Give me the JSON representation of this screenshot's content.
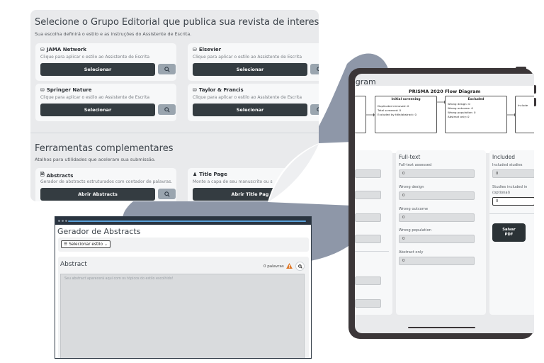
{
  "publisher_panel": {
    "title": "Selecione o Grupo Editorial que publica sua revista de interesse",
    "subtitle": "Sua escolha definirá o estilo e as instruções do Assistente de Escrita.",
    "card_description": "Clique para aplicar o estilo ao Assistente de Escrita",
    "select_label": "Selecionar",
    "publishers": [
      {
        "name": "JAMA Network",
        "icon": "database-icon"
      },
      {
        "name": "Elsevier",
        "icon": "database-icon"
      },
      {
        "name": "Springer Nature",
        "icon": "database-icon"
      },
      {
        "name": "Taylor & Francis",
        "icon": "database-icon"
      }
    ],
    "tools_title": "Ferramentas complementares",
    "tools_subtitle": "Atalhos para utilidades que aceleram sua submissão.",
    "tools": [
      {
        "name": "Abstracts",
        "description": "Gerador de abstracts estruturados com contador de palavras.",
        "button": "Abrir Abstracts",
        "icon": "document-icon"
      },
      {
        "name": "Title Page",
        "description": "Monte a capa de seu manuscrito ou s",
        "button": "Abrir Title Pag",
        "icon": "user-group-icon"
      }
    ]
  },
  "abstract_window": {
    "title": "Gerador de Abstracts",
    "style_button": "Selecionar estilo",
    "section_title": "Abstract",
    "word_count": "0 palavras",
    "placeholder": "Seu abstract aparecerá aqui com os tópicos do estilo escolhido!"
  },
  "tablet": {
    "partial_title": "agram",
    "prisma": {
      "title": "PRISMA 2020 Flow Diagram",
      "initial_screening": {
        "title": "Initial screening",
        "lines": [
          "Duplicated removed: 0",
          "Total screened: 0",
          "Excluded by title/abstract: 0"
        ]
      },
      "excluded": {
        "title": "Excluded",
        "lines": [
          "Wrong design: 0",
          "Wrong outcome: 0",
          "Wrong population: 0",
          "Abstract only: 0"
        ]
      },
      "partial_box": "Include"
    },
    "fulltext": {
      "title": "Full-text",
      "fields": [
        {
          "label": "Full-text assessed",
          "value": "0"
        },
        {
          "label": "Wrong design",
          "value": "0"
        },
        {
          "label": "Wrong outcome",
          "value": "0"
        },
        {
          "label": "Wrong population",
          "value": "0"
        },
        {
          "label": "Abstract only",
          "value": "0"
        }
      ]
    },
    "included": {
      "title": "Included",
      "studies_label": "Included studies",
      "studies_value": "0",
      "optional_label_1": "Studies included in",
      "optional_label_2": "(optional)",
      "optional_value": "0",
      "save_line1": "Salvar",
      "save_line2": "PDF"
    }
  },
  "colors": {
    "dark_button": "#343c41",
    "blob": "#8e97a8",
    "panel_bg": "#e9eaec",
    "tablet_frame": "#3b3638"
  }
}
